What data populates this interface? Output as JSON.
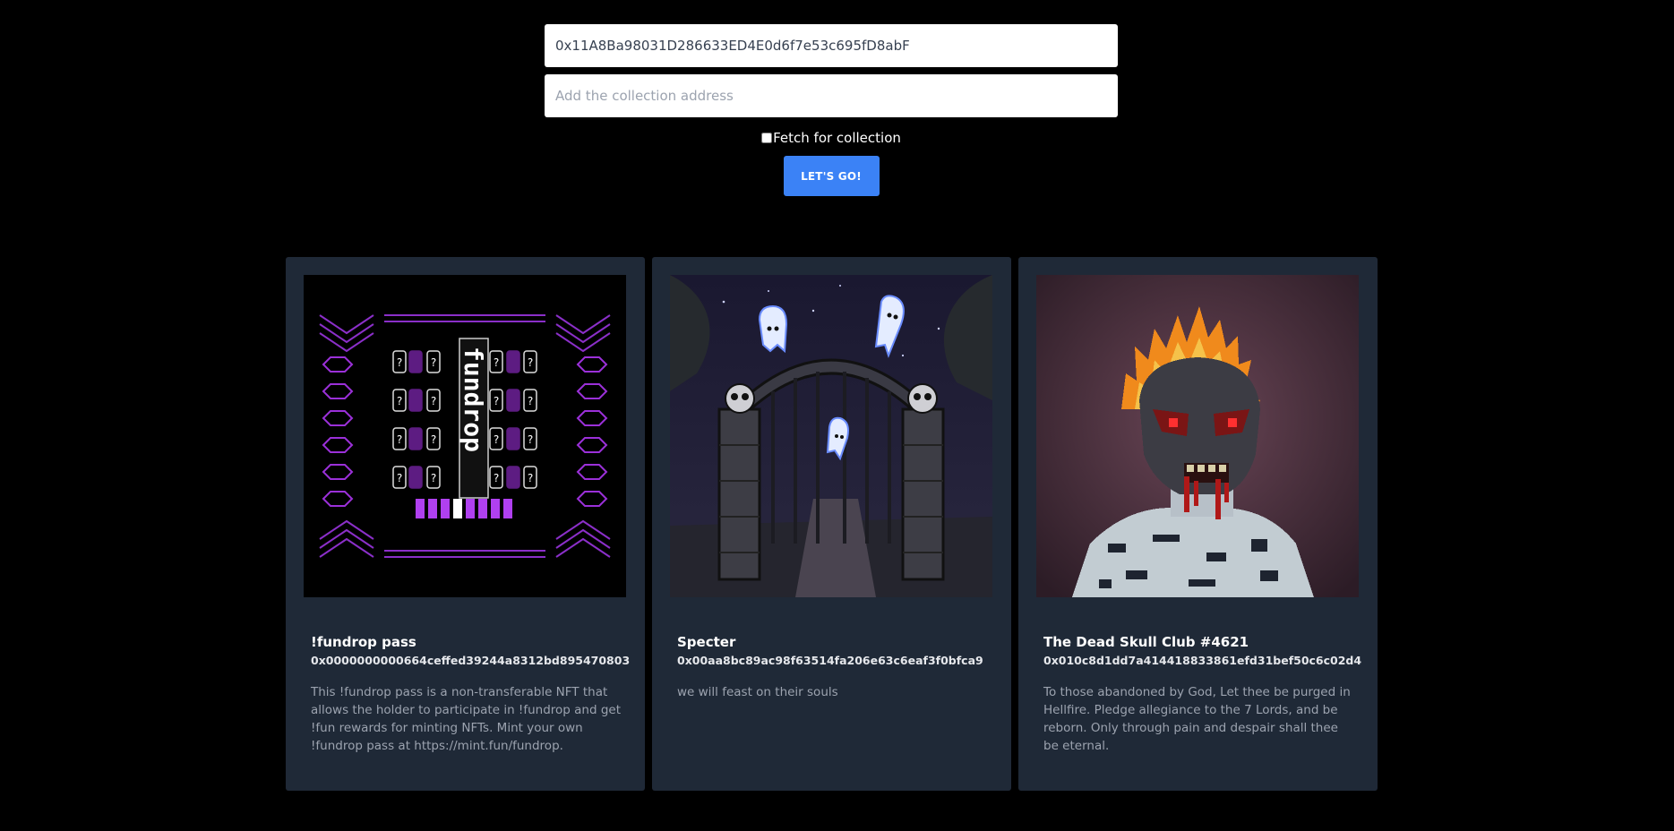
{
  "form": {
    "wallet_value": "0x11A8Ba98031D286633ED4E0d6f7e53c695fD8abF",
    "collection_placeholder": "Add the collection address",
    "fetch_label": "Fetch for collection",
    "go_label": "LET'S GO!"
  },
  "cards": [
    {
      "title": "!fundrop pass",
      "address": "0x0000000000664ceffed39244a8312bd895470803",
      "description": "This !fundrop pass is a non-transferable NFT that allows the holder to participate in !fundrop and get !fun rewards for minting NFTs. Mint your own !fundrop pass at https://mint.fun/fundrop.",
      "image_art": "fundrop",
      "image_text": "fundrop"
    },
    {
      "title": "Specter",
      "address": "0x00aa8bc89ac98f63514fa206e63c6eaf3f0bfca9",
      "description": "we will feast on their souls",
      "image_art": "haunted-gate"
    },
    {
      "title": "The Dead Skull Club #4621",
      "address": "0x010c8d1dd7a414418833861efd31bef50c6c02d4",
      "description": "To those abandoned by God, Let thee be purged in Hellfire. Pledge allegiance to the 7 Lords, and be reborn. Only through pain and despair shall thee be eternal.",
      "image_art": "flaming-skull"
    }
  ],
  "colors": {
    "background": "#000000",
    "card": "#1f2937",
    "button": "#3b82f6",
    "fundrop_purple": "#9b30d9"
  }
}
